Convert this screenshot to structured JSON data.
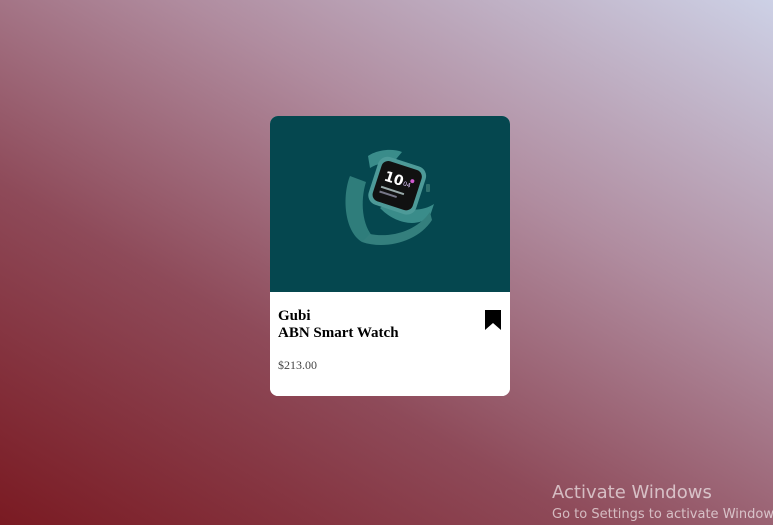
{
  "product": {
    "brand": "Gubi",
    "name": "ABN Smart Watch",
    "price": "$213.00",
    "image_icon": "smartwatch-image",
    "bookmark_icon": "bookmark-icon"
  },
  "watch_face": {
    "time": "10",
    "time_suffix": "04"
  },
  "colors": {
    "card_image_bg": "#05474f",
    "watch_strap": "#3a8c8a",
    "card_bg": "#ffffff"
  },
  "os_watermark": {
    "title": "Activate Windows",
    "subtitle": "Go to Settings to activate Windows."
  }
}
